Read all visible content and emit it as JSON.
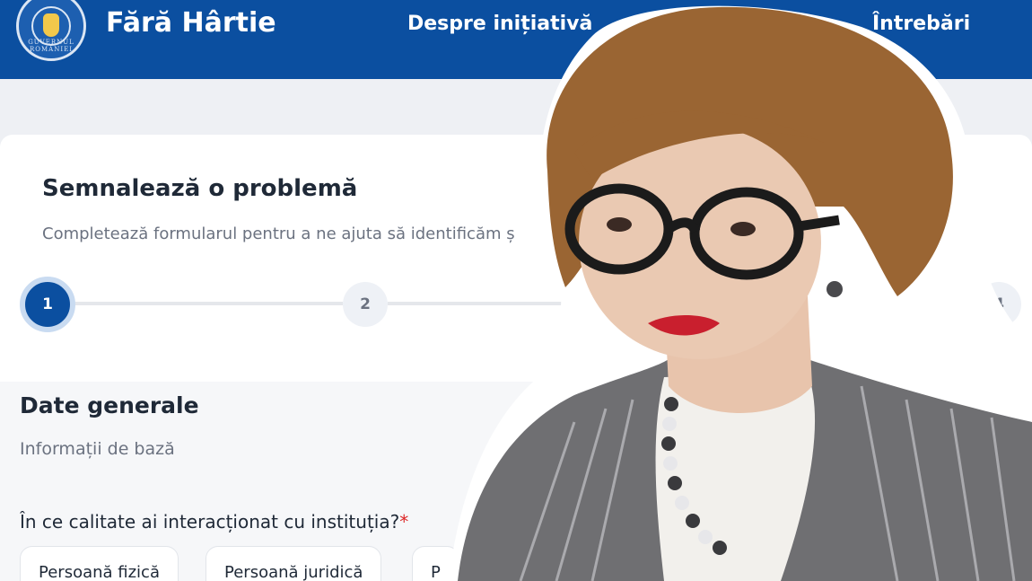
{
  "header": {
    "logo_text": "GUVERNUL ROMÂNIEI",
    "brand": "Fără Hârtie",
    "nav": [
      "Despre inițiativă",
      "Întrebări"
    ]
  },
  "form": {
    "title": "Semnalează o problemă",
    "subtitle": "Completează formularul pentru a ne ajuta să identificăm ș",
    "steps": [
      "1",
      "2",
      "4"
    ],
    "active_step": "1"
  },
  "section": {
    "title": "Date generale",
    "subtitle": "Informații de bază",
    "question": "În ce calitate ai interacționat cu instituția?",
    "required_mark": "*",
    "options": [
      "Persoană fizică",
      "Persoană juridică",
      "P"
    ]
  },
  "colors": {
    "header_bg": "#0b4fa0",
    "accent": "#0b4fa0",
    "required": "#dc2626"
  },
  "icons": {
    "logo": "government-seal-icon"
  }
}
